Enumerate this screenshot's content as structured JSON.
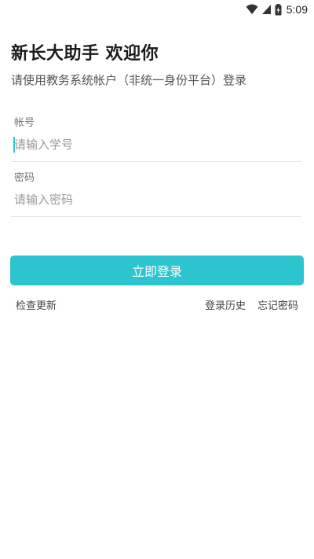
{
  "status_bar": {
    "time": "5:09",
    "icons": [
      "wifi-icon",
      "cellular-signal-icon",
      "battery-charging-icon"
    ]
  },
  "header": {
    "title": "新长大助手 欢迎你",
    "subtitle": "请使用教务系统帐户（非统一身份平台）登录"
  },
  "form": {
    "username": {
      "label": "帐号",
      "value": "",
      "placeholder": "请输入学号"
    },
    "password": {
      "label": "密码",
      "value": "",
      "placeholder": "请输入密码"
    }
  },
  "actions": {
    "login_label": "立即登录",
    "check_update_label": "检查更新",
    "login_history_label": "登录历史",
    "forgot_password_label": "忘记密码"
  },
  "colors": {
    "accent": "#2bc4cf",
    "title_text": "#1b1b1b",
    "subtitle_text": "#555555"
  }
}
